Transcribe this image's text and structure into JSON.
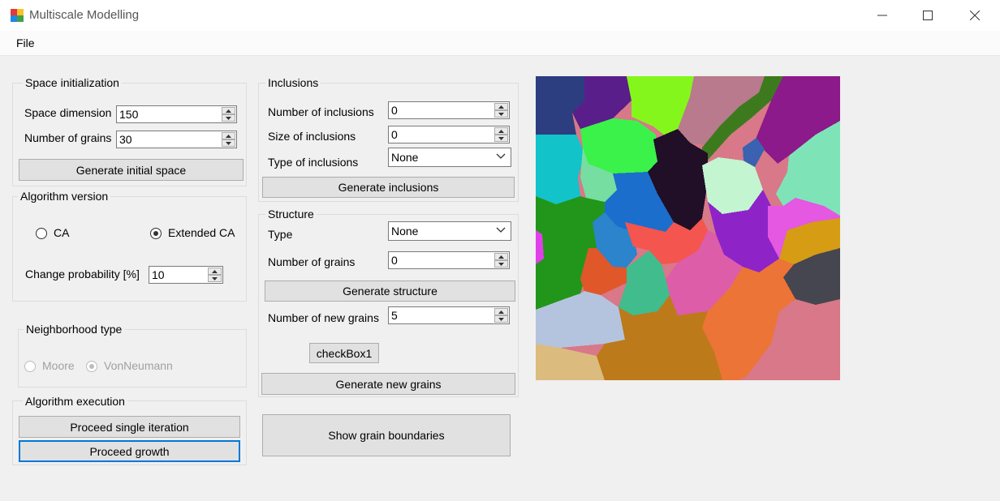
{
  "window": {
    "title": "Multiscale Modelling"
  },
  "menu": {
    "file": "File"
  },
  "space_init": {
    "title": "Space initialization",
    "dimension_label": "Space dimension",
    "dimension_value": "150",
    "grains_label": "Number of grains",
    "grains_value": "30",
    "generate_button": "Generate initial space"
  },
  "algorithm_version": {
    "title": "Algorithm version",
    "option_ca": "CA",
    "option_extended": "Extended CA",
    "probability_label": "Change probability [%]",
    "probability_value": "10"
  },
  "neighborhood": {
    "title": "Neighborhood type",
    "option_moore": "Moore",
    "option_vonneumann": "VonNeumann"
  },
  "execution": {
    "title": "Algorithm execution",
    "single_button": "Proceed single iteration",
    "growth_button": "Proceed growth"
  },
  "inclusions": {
    "title": "Inclusions",
    "number_label": "Number of inclusions",
    "number_value": "0",
    "size_label": "Size of inclusions",
    "size_value": "0",
    "type_label": "Type of inclusions",
    "type_value": "None",
    "generate_button": "Generate inclusions"
  },
  "structure": {
    "title": "Structure",
    "type_label": "Type",
    "type_value": "None",
    "grains_label": "Number of grains",
    "grains_value": "0",
    "generate_button": "Generate structure",
    "new_grains_label": "Number of new grains",
    "new_grains_value": "5",
    "checkbox_label": "checkBox1",
    "generate_new_button": "Generate new grains"
  },
  "boundaries_button": "Show grain boundaries",
  "colors": {
    "accent": "#0078d7"
  }
}
